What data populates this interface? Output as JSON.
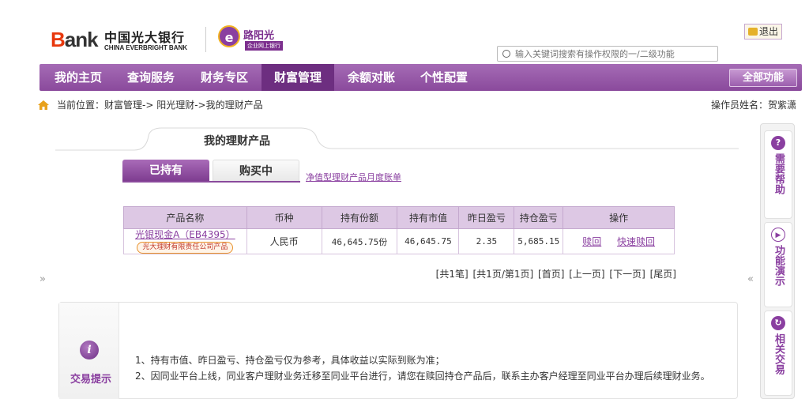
{
  "header": {
    "bank_logo_text": "Bank",
    "bank_name_cn": "中国光大银行",
    "bank_name_en": "CHINA EVERBRIGHT BANK",
    "yangguang_title": "阳光",
    "yangguang_sub": "企业网上银行",
    "exit_label": "退出",
    "search_placeholder": "输入关键词搜索有操作权限的一/二级功能"
  },
  "nav": {
    "items": [
      "我的主页",
      "查询服务",
      "财务专区",
      "财富管理",
      "余额对账",
      "个性配置"
    ],
    "active": "财富管理",
    "all_functions": "全部功能"
  },
  "breadcrumb": {
    "label": "当前位置：",
    "path": "财富管理->  阳光理财->我的理财产品",
    "operator": "操作员姓名：贺紫潇"
  },
  "main": {
    "tab_title": "我的理财产品",
    "subtabs": [
      "已持有",
      "购买中"
    ],
    "monthly_link": "净值型理财产品月度账单",
    "table": {
      "headers": [
        "产品名称",
        "币种",
        "持有份额",
        "持有市值",
        "昨日盈亏",
        "持仓盈亏",
        "操作"
      ],
      "rows": [
        {
          "name": "光银现金A（EB4395）",
          "tag": "光大理财有限责任公司产品",
          "currency": "人民币",
          "shares": "46,645.75份",
          "market_value": "46,645.75",
          "yesterday_pl": "2.35",
          "position_pl": "5,685.15",
          "actions": [
            "赎回",
            "快速赎回"
          ]
        }
      ]
    },
    "pager": [
      "[共1笔]",
      "[共1页/第1页]",
      "[首页]",
      "[上一页]",
      "[下一页]",
      "[尾页]"
    ]
  },
  "tips": {
    "label": "交易提示",
    "lines": [
      "1、持有市值、昨日盈亏、持仓盈亏仅为参考，具体收益以实际到账为准；",
      "2、因同业平台上线，同业客户理财业务迁移至同业平台进行，请您在赎回持仓产品后，联系主办客户经理至同业平台办理后续理财业务。"
    ]
  },
  "side": {
    "items": [
      "需要帮助",
      "功能演示",
      "相关交易"
    ]
  },
  "arrows": {
    "expand": "»",
    "collapse": "«"
  }
}
